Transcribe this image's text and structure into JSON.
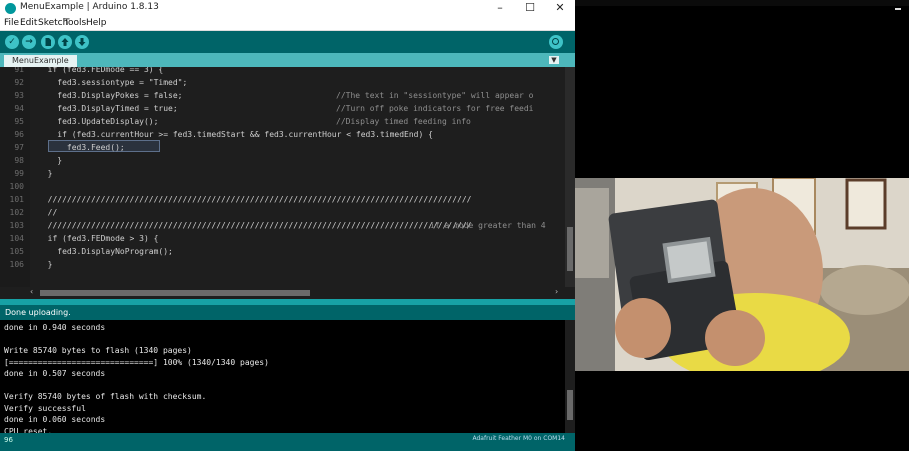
{
  "window": {
    "title": "MenuExample | Arduino 1.8.13",
    "minimize": "–",
    "maximize": "☐",
    "close": "✕"
  },
  "menu": [
    "File",
    "Edit",
    "Sketch",
    "Tools",
    "Help"
  ],
  "toolbar": {
    "verify_icon": "✓",
    "upload_icon": "→"
  },
  "tab": {
    "name": "MenuExample",
    "menu_icon": "▼"
  },
  "editor": {
    "lines": [
      {
        "n": "91",
        "code": "  if (fed3.FEDmode == 3) {"
      },
      {
        "n": "92",
        "code": "    fed3.sessiontype = \"Timed\";"
      },
      {
        "n": "93",
        "code": "    fed3.DisplayPokes = false;"
      },
      {
        "n": "94",
        "code": "    fed3.DisplayTimed = true;"
      },
      {
        "n": "95",
        "code": "    fed3.UpdateDisplay();"
      },
      {
        "n": "96",
        "code": "    if (fed3.currentHour >= fed3.timedStart && fed3.currentHour < fed3.timedEnd) {"
      },
      {
        "n": "97",
        "code": "      fed3.Feed();"
      },
      {
        "n": "98",
        "code": "    }"
      },
      {
        "n": "99",
        "code": "  }"
      },
      {
        "n": "100",
        "code": ""
      },
      {
        "n": "101",
        "code": "  ////////////////////////////////////////////////////////////////////////////////////////"
      },
      {
        "n": "102",
        "code": "  //"
      },
      {
        "n": "103",
        "code": "  ////////////////////////////////////////////////////////////////////////////////////////"
      },
      {
        "n": "104",
        "code": "  if (fed3.FEDmode > 3) {"
      },
      {
        "n": "105",
        "code": "    fed3.DisplayNoProgram();"
      },
      {
        "n": "106",
        "code": "  }"
      }
    ],
    "comments": {
      "c92": "//The text in \"sessiontype\" will appear o",
      "c93": "//Turn off poke indicators for free feedi",
      "c94": "//Display timed feeding info",
      "c102": "if a mode greater than 4"
    }
  },
  "status": {
    "message": "Done uploading."
  },
  "console": [
    "done in 0.940 seconds",
    "",
    "Write 85740 bytes to flash (1340 pages)",
    "[==============================] 100% (1340/1340 pages)",
    "done in 0.507 seconds",
    "",
    "Verify 85740 bytes of flash with checksum.",
    "Verify successful",
    "done in 0.060 seconds",
    "CPU reset."
  ],
  "bottom": {
    "line_number": "96",
    "board": "Adafruit Feather M0 on COM14"
  },
  "colors": {
    "teal": "#17a1a5",
    "toolbar": "#006468",
    "editor_bg": "#1e1e1e"
  }
}
